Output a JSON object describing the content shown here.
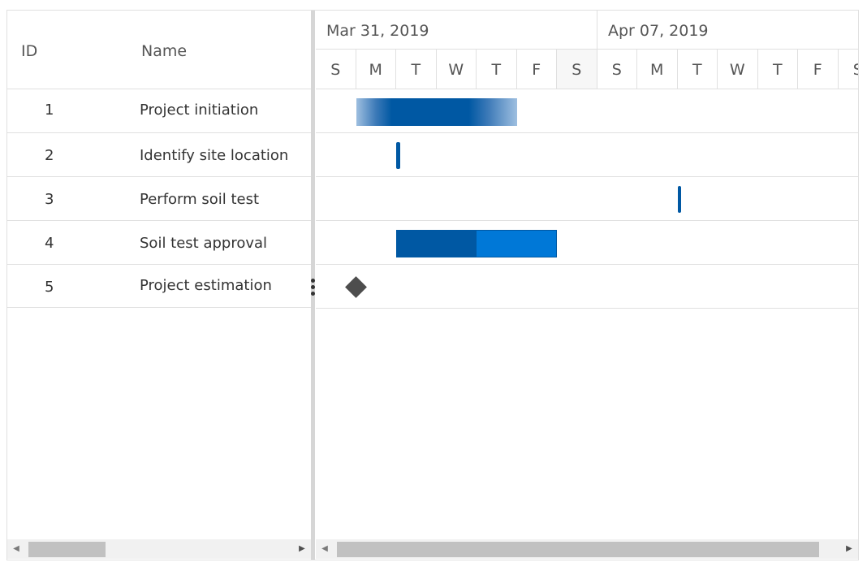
{
  "grid": {
    "columns": {
      "id": "ID",
      "name": "Name"
    },
    "rows": [
      {
        "id": "1",
        "name": "Project initiation"
      },
      {
        "id": "2",
        "name": "Identify site location"
      },
      {
        "id": "3",
        "name": "Perform soil test"
      },
      {
        "id": "4",
        "name": "Soil test approval"
      },
      {
        "id": "5",
        "name": "Project estimation"
      }
    ]
  },
  "timeline": {
    "weeks": [
      "Mar 31, 2019",
      "Apr 07, 2019"
    ],
    "days": [
      "S",
      "M",
      "T",
      "W",
      "T",
      "F",
      "S",
      "S",
      "M",
      "T",
      "W",
      "T",
      "F",
      "S"
    ]
  },
  "tasks": {
    "task4_progress": 0.5
  },
  "colors": {
    "task_bar": "#0078d7",
    "task_progress": "#0058a3",
    "milestone": "#4d4d4d"
  },
  "icons": {
    "splitter": "vertical-ellipsis-icon",
    "scroll_left": "triangle-left-icon",
    "scroll_right": "triangle-right-icon"
  }
}
